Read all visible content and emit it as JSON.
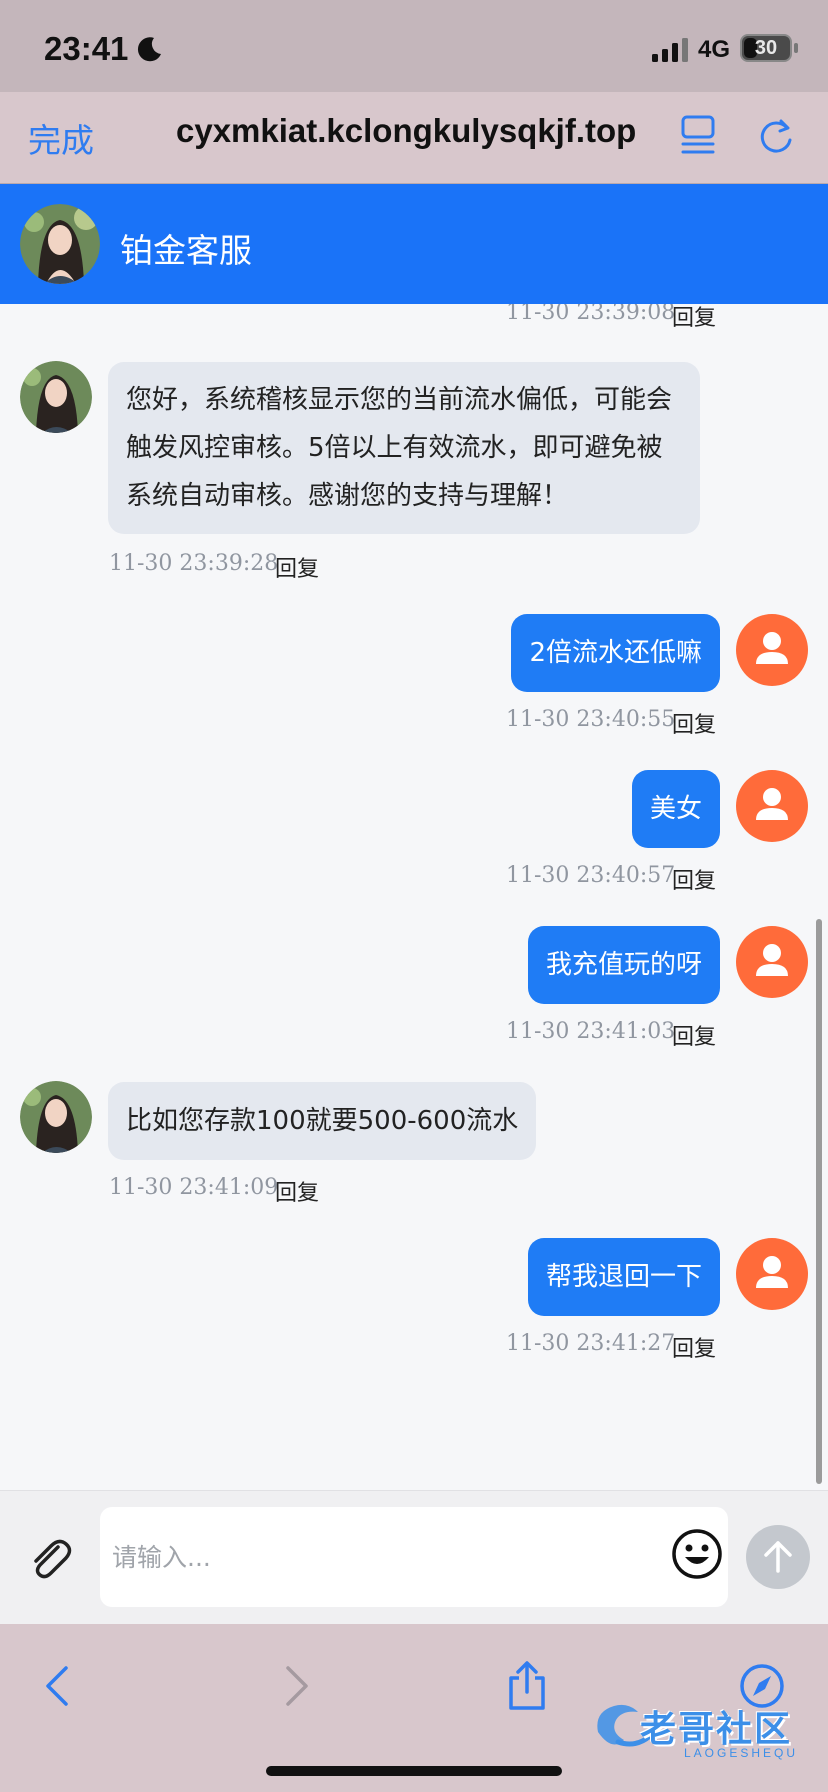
{
  "status_bar": {
    "time": "23:41",
    "network": "4G",
    "battery": "30",
    "battery_fraction": 0.3
  },
  "browser": {
    "done_label": "完成",
    "url": "cyxmkiat.kclongkulysqkjf.top"
  },
  "chat": {
    "title": "铂金客服",
    "reply_label": "回复",
    "messages": [
      {
        "sender": "agent",
        "text": "",
        "time": "11-30 23:39:08"
      },
      {
        "sender": "agent",
        "text": "您好，系统稽核显示您的当前流水偏低，可能会触发风控审核。5倍以上有效流水，即可避免被系统自动审核。感谢您的支持与理解！",
        "time": "11-30 23:39:28"
      },
      {
        "sender": "user",
        "text": "2倍流水还低嘛",
        "time": "11-30 23:40:55"
      },
      {
        "sender": "user",
        "text": "美女",
        "time": "11-30 23:40:57"
      },
      {
        "sender": "user",
        "text": "我充值玩的呀",
        "time": "11-30 23:41:03"
      },
      {
        "sender": "agent",
        "text": "比如您存款100就要500-600流水",
        "time": "11-30 23:41:09"
      },
      {
        "sender": "user",
        "text": "帮我退回一下",
        "time": "11-30 23:41:27"
      }
    ]
  },
  "input": {
    "placeholder": "请输入..."
  },
  "watermark": {
    "text": "老哥社区",
    "sub": "LAOGESHEQU"
  },
  "colors": {
    "header": "#1a73f8",
    "user_bubble": "#1f7cf5",
    "agent_bubble": "#e4e8ef",
    "user_avatar": "#ff6b3a"
  },
  "icons": {
    "status": [
      "moon-icon",
      "signal-icon",
      "battery-icon"
    ],
    "browser": [
      "reader-icon",
      "reload-icon"
    ],
    "input": [
      "paperclip-icon",
      "emoji-icon",
      "send-arrow-icon"
    ],
    "toolbar": [
      "back-icon",
      "forward-icon",
      "share-icon",
      "compass-icon"
    ]
  }
}
